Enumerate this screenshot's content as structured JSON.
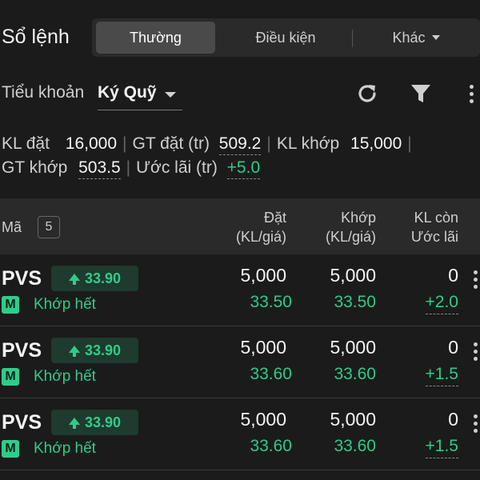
{
  "header": {
    "title": "Sổ lệnh",
    "tabs": [
      {
        "label": "Thường",
        "active": true
      },
      {
        "label": "Điều kiện",
        "active": false
      },
      {
        "label": "Khác",
        "active": false
      }
    ]
  },
  "account": {
    "label": "Tiểu khoản",
    "value": "Ký Quỹ"
  },
  "icons": {
    "refresh": "refresh-icon",
    "filter": "filter-icon",
    "more": "more-vertical-icon"
  },
  "stats": {
    "kl_dat_label": "KL đặt",
    "kl_dat_value": "16,000",
    "gt_dat_label": "GT đặt (tr)",
    "gt_dat_value": "509.2",
    "kl_khop_label": "KL khớp",
    "kl_khop_value": "15,000",
    "gt_khop_label": "GT khớp",
    "gt_khop_value": "503.5",
    "uoc_lai_label": "Ước lãi (tr)",
    "uoc_lai_value": "+5.0"
  },
  "table": {
    "col_ma": "Mã",
    "count": "5",
    "col_dat_1": "Đặt",
    "col_dat_2": "(KL/giá)",
    "col_khop_1": "Khớp",
    "col_khop_2": "(KL/giá)",
    "col_con_1": "KL còn",
    "col_con_2": "Ước lãi",
    "rows": [
      {
        "symbol": "PVS",
        "price": "33.90",
        "badge": "M",
        "status": "Khớp hết",
        "dat_qty": "5,000",
        "dat_price": "33.50",
        "khop_qty": "5,000",
        "khop_price": "33.50",
        "remain": "0",
        "pnl": "+2.0"
      },
      {
        "symbol": "PVS",
        "price": "33.90",
        "badge": "M",
        "status": "Khớp hết",
        "dat_qty": "5,000",
        "dat_price": "33.60",
        "khop_qty": "5,000",
        "khop_price": "33.60",
        "remain": "0",
        "pnl": "+1.5"
      },
      {
        "symbol": "PVS",
        "price": "33.90",
        "badge": "M",
        "status": "Khớp hết",
        "dat_qty": "5,000",
        "dat_price": "33.60",
        "khop_qty": "5,000",
        "khop_price": "33.60",
        "remain": "0",
        "pnl": "+1.5"
      }
    ]
  },
  "colors": {
    "background": "#1b1b1b",
    "positive": "#2ecc8a"
  }
}
